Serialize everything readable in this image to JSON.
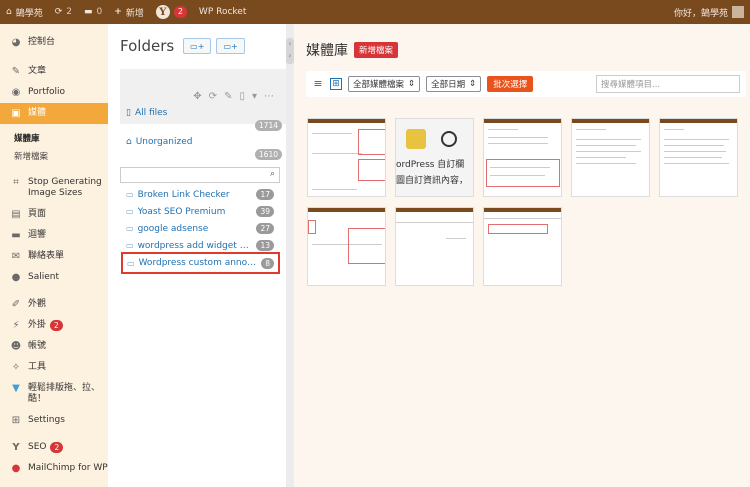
{
  "adminbar": {
    "site_name": "鵠學苑",
    "updates_count": "2",
    "comments_count": "0",
    "new_label": "新增",
    "seo_badge": "2",
    "wp_rocket": "WP Rocket",
    "greeting": "你好，鵠學苑"
  },
  "sidebar": {
    "items": [
      {
        "label": "控制台",
        "icon": "dashboard-icon",
        "glyph": "◕"
      },
      {
        "label": "文章",
        "icon": "pin-icon",
        "glyph": "✎"
      },
      {
        "label": "Portfolio",
        "icon": "portfolio-icon",
        "glyph": "◉"
      },
      {
        "label": "媒體",
        "icon": "media-icon",
        "glyph": "▣"
      },
      {
        "label": "Stop Generating Image Sizes",
        "icon": "crop-icon",
        "glyph": "⌗"
      },
      {
        "label": "頁面",
        "icon": "page-icon",
        "glyph": "▤"
      },
      {
        "label": "迴響",
        "icon": "comment-icon",
        "glyph": "▬"
      },
      {
        "label": "聯絡表單",
        "icon": "mail-icon",
        "glyph": "✉"
      },
      {
        "label": "Salient",
        "icon": "salient-icon",
        "glyph": "●"
      },
      {
        "label": "外觀",
        "icon": "brush-icon",
        "glyph": "✐"
      },
      {
        "label": "外掛",
        "icon": "plugin-icon",
        "glyph": "⚡",
        "badge": "2"
      },
      {
        "label": "帳號",
        "icon": "user-icon",
        "glyph": "☻"
      },
      {
        "label": "工具",
        "icon": "wrench-icon",
        "glyph": "✧"
      },
      {
        "label": "輕鬆排版拖、拉、酷！",
        "icon": "visual-composer-icon",
        "glyph": "▼"
      },
      {
        "label": "Settings",
        "icon": "settings-icon",
        "glyph": "⊞"
      },
      {
        "label": "SEO",
        "icon": "yoast-icon",
        "glyph": "Y",
        "badge": "2"
      },
      {
        "label": "MailChimp for WP",
        "icon": "mailchimp-icon",
        "glyph": "●"
      }
    ],
    "submenu": [
      "媒體庫",
      "新增檔案"
    ]
  },
  "folders": {
    "title": "Folders",
    "new_folder_btn": "+",
    "new_subfolder_btn": "+",
    "all_files": {
      "label": "All files",
      "count": "1714"
    },
    "unorganized": {
      "label": "Unorganized",
      "count": "1610"
    },
    "list": [
      {
        "name": "Broken Link Checker",
        "count": "17"
      },
      {
        "name": "Yoast SEO Premium",
        "count": "39"
      },
      {
        "name": "google adsense",
        "count": "27"
      },
      {
        "name": "wordpress add widget bloock",
        "count": "13"
      },
      {
        "name": "Wordpress custom announc...",
        "count": "8"
      }
    ]
  },
  "main": {
    "title": "媒體庫",
    "add_new": "新增檔案",
    "type_filter": "全部媒體檔案",
    "date_filter": "全部日期",
    "bulk_select": "批次選擇",
    "search_placeholder": "搜尋媒體項目...",
    "thumb2_text_a": "ordPress 自訂欄",
    "thumb2_text_b": "圖自訂資訊內容，"
  },
  "colors": {
    "adminbar": "#7a4a1f",
    "sidebar_bg": "#fdf1df",
    "active_menu": "#f2a83a",
    "accent_red": "#d63638",
    "bulk_button": "#e8541c",
    "link_blue": "#2271b1"
  }
}
